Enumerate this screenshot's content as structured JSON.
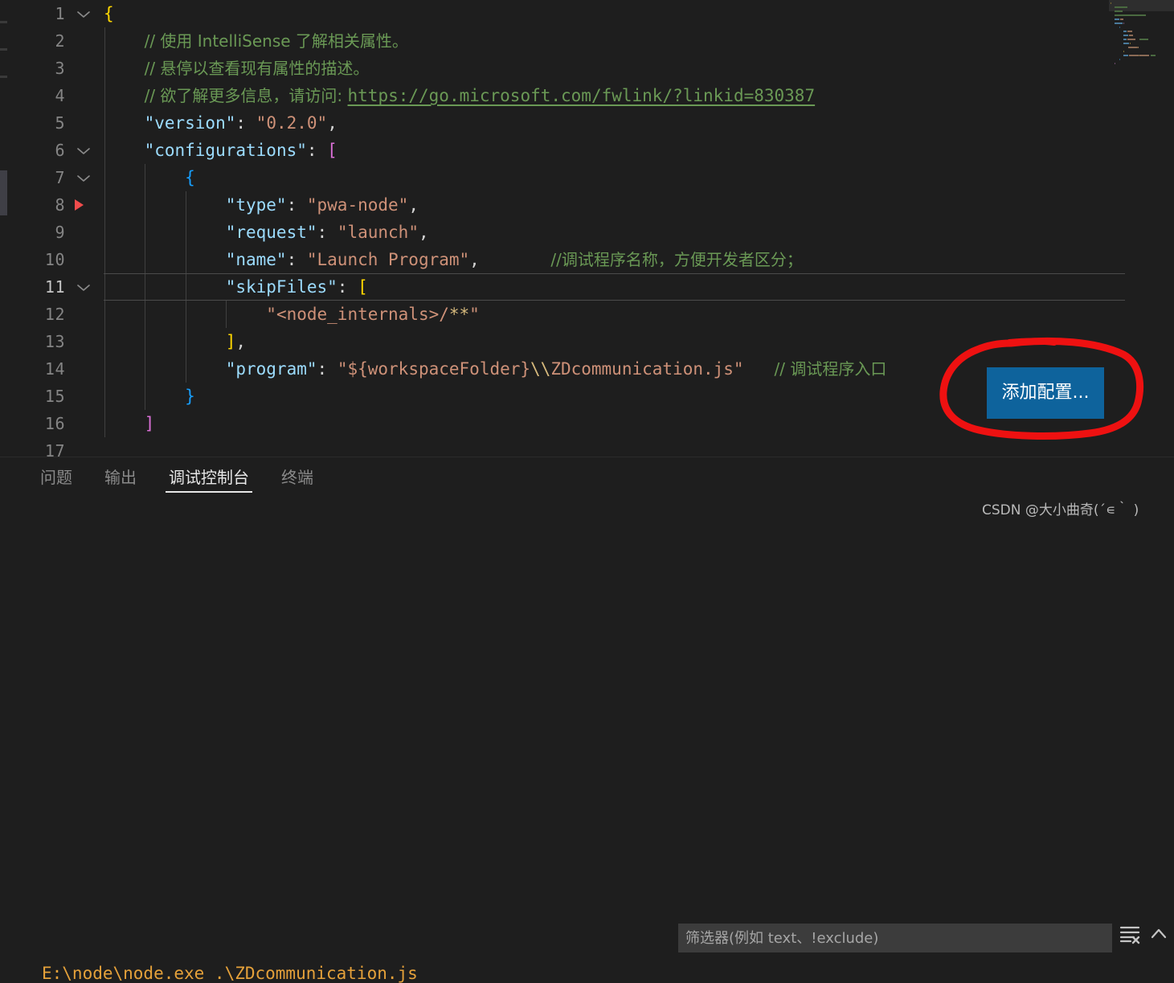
{
  "editor": {
    "language": "json",
    "file_kind": "launch-configuration",
    "active_line": 11,
    "breakpoint_line": 8,
    "lines": [
      {
        "num": "1",
        "fold": "open",
        "indent_guides": 0,
        "tokens": [
          {
            "t": "{",
            "c": "br"
          }
        ]
      },
      {
        "num": "2",
        "fold": "",
        "indent_guides": 1,
        "tokens": [
          {
            "t": "    ",
            "c": "p"
          },
          {
            "t": "// 使用 IntelliSense 了解相关属性。",
            "c": "c cjk"
          }
        ]
      },
      {
        "num": "3",
        "fold": "",
        "indent_guides": 1,
        "tokens": [
          {
            "t": "    ",
            "c": "p"
          },
          {
            "t": "// 悬停以查看现有属性的描述。",
            "c": "c cjk"
          }
        ]
      },
      {
        "num": "4",
        "fold": "",
        "indent_guides": 1,
        "tokens": [
          {
            "t": "    ",
            "c": "p"
          },
          {
            "t": "// 欲了解更多信息，请访问: ",
            "c": "c cjk"
          },
          {
            "t": "https://go.microsoft.com/fwlink/?linkid=830387",
            "c": "lnk"
          }
        ]
      },
      {
        "num": "5",
        "fold": "",
        "indent_guides": 1,
        "tokens": [
          {
            "t": "    ",
            "c": "p"
          },
          {
            "t": "\"version\"",
            "c": "k"
          },
          {
            "t": ": ",
            "c": "p"
          },
          {
            "t": "\"0.2.0\"",
            "c": "s"
          },
          {
            "t": ",",
            "c": "p"
          }
        ]
      },
      {
        "num": "6",
        "fold": "open",
        "indent_guides": 1,
        "tokens": [
          {
            "t": "    ",
            "c": "p"
          },
          {
            "t": "\"configurations\"",
            "c": "k"
          },
          {
            "t": ": ",
            "c": "p"
          },
          {
            "t": "[",
            "c": "br2"
          }
        ]
      },
      {
        "num": "7",
        "fold": "open",
        "indent_guides": 2,
        "tokens": [
          {
            "t": "        ",
            "c": "p"
          },
          {
            "t": "{",
            "c": "br3"
          }
        ]
      },
      {
        "num": "8",
        "fold": "",
        "indent_guides": 3,
        "tokens": [
          {
            "t": "            ",
            "c": "p"
          },
          {
            "t": "\"type\"",
            "c": "k"
          },
          {
            "t": ": ",
            "c": "p"
          },
          {
            "t": "\"pwa-node\"",
            "c": "s"
          },
          {
            "t": ",",
            "c": "p"
          }
        ]
      },
      {
        "num": "9",
        "fold": "",
        "indent_guides": 3,
        "tokens": [
          {
            "t": "            ",
            "c": "p"
          },
          {
            "t": "\"request\"",
            "c": "k"
          },
          {
            "t": ": ",
            "c": "p"
          },
          {
            "t": "\"launch\"",
            "c": "s"
          },
          {
            "t": ",",
            "c": "p"
          }
        ]
      },
      {
        "num": "10",
        "fold": "",
        "indent_guides": 3,
        "tokens": [
          {
            "t": "            ",
            "c": "p"
          },
          {
            "t": "\"name\"",
            "c": "k"
          },
          {
            "t": ": ",
            "c": "p"
          },
          {
            "t": "\"Launch Program\"",
            "c": "s"
          },
          {
            "t": ",",
            "c": "p"
          },
          {
            "t": "       ",
            "c": "p"
          },
          {
            "t": "//调试程序名称，方便开发者区分；",
            "c": "c cjk"
          }
        ]
      },
      {
        "num": "11",
        "fold": "open",
        "indent_guides": 3,
        "tokens": [
          {
            "t": "            ",
            "c": "p"
          },
          {
            "t": "\"skipFiles\"",
            "c": "k"
          },
          {
            "t": ": ",
            "c": "p"
          },
          {
            "t": "[",
            "c": "br"
          }
        ]
      },
      {
        "num": "12",
        "fold": "",
        "indent_guides": 4,
        "tokens": [
          {
            "t": "                ",
            "c": "p"
          },
          {
            "t": "\"<node_internals>/",
            "c": "s"
          },
          {
            "t": "**",
            "c": "esc"
          },
          {
            "t": "\"",
            "c": "s"
          }
        ]
      },
      {
        "num": "13",
        "fold": "",
        "indent_guides": 3,
        "tokens": [
          {
            "t": "            ",
            "c": "p"
          },
          {
            "t": "]",
            "c": "br"
          },
          {
            "t": ",",
            "c": "p"
          }
        ]
      },
      {
        "num": "14",
        "fold": "",
        "indent_guides": 3,
        "tokens": [
          {
            "t": "            ",
            "c": "p"
          },
          {
            "t": "\"program\"",
            "c": "k"
          },
          {
            "t": ": ",
            "c": "p"
          },
          {
            "t": "\"${workspaceFolder}",
            "c": "s"
          },
          {
            "t": "\\\\",
            "c": "esc"
          },
          {
            "t": "ZDcommunication.js\"",
            "c": "s"
          },
          {
            "t": "   ",
            "c": "p"
          },
          {
            "t": "// 调试程序入口",
            "c": "c cjk"
          }
        ]
      },
      {
        "num": "15",
        "fold": "",
        "indent_guides": 2,
        "tokens": [
          {
            "t": "        ",
            "c": "p"
          },
          {
            "t": "}",
            "c": "br3"
          }
        ]
      },
      {
        "num": "16",
        "fold": "",
        "indent_guides": 1,
        "tokens": [
          {
            "t": "    ",
            "c": "p"
          },
          {
            "t": "]",
            "c": "br2"
          }
        ]
      },
      {
        "num": "17",
        "fold": "",
        "indent_guides": 0,
        "tokens": []
      }
    ]
  },
  "add_config_button": {
    "label": "添加配置...",
    "color": "#0e639c"
  },
  "annotation": {
    "kind": "hand-drawn-circle",
    "color": "#ee1111",
    "target": "add-config-button"
  },
  "panel": {
    "tabs": [
      {
        "label": "问题",
        "active": false
      },
      {
        "label": "输出",
        "active": false
      },
      {
        "label": "调试控制台",
        "active": true
      },
      {
        "label": "终端",
        "active": false
      }
    ],
    "filter": {
      "value": "",
      "placeholder": "筛选器(例如 text、!exclude)"
    },
    "actions": [
      {
        "name": "clear-console-icon",
        "title": "清除控制台"
      },
      {
        "name": "chevron-up-icon",
        "title": "折叠面板"
      }
    ],
    "console_output": "E:\\node\\node.exe .\\ZDcommunication.js"
  },
  "watermark": {
    "text": "CSDN @大小曲奇(´∊｀   )"
  },
  "theme": {
    "background": "#1e1e1e",
    "key_color": "#9cdcfe",
    "string_color": "#ce9178",
    "comment_color": "#6a9955",
    "accent": "#0e639c",
    "breakpoint": "#f14c4c",
    "console_text": "#e5a13a"
  }
}
